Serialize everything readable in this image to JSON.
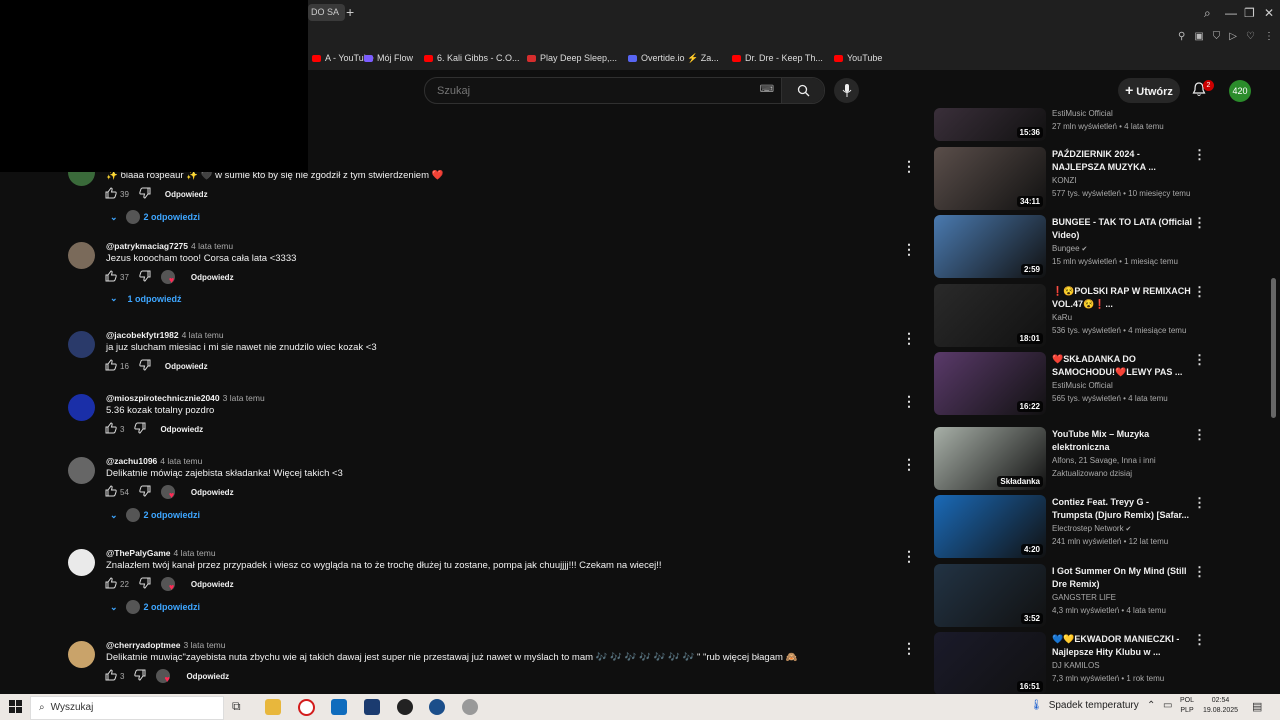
{
  "browser": {
    "active_tab": "DO SA",
    "bookmarks": [
      {
        "label": "A - YouTube",
        "color": "#ff0000"
      },
      {
        "label": "Mój Flow",
        "color": "#7b5cff"
      },
      {
        "label": "6. Kali Gibbs - C.O...",
        "color": "#ff0000"
      },
      {
        "label": "Play Deep Sleep,...",
        "color": "#d62d2d"
      },
      {
        "label": "Overtide.io ⚡ Za...",
        "color": "#5865f2"
      },
      {
        "label": "Dr. Dre - Keep Th...",
        "color": "#ff0000"
      },
      {
        "label": "YouTube",
        "color": "#ff0000"
      }
    ]
  },
  "header": {
    "search_placeholder": "Szukaj",
    "create_label": "Utwórz",
    "notif_count": "2",
    "avatar_text": "420"
  },
  "comments": [
    {
      "author": "",
      "time": "",
      "text": "✨ бiаaa гозрeaur ✨ 🖤 w sumie kto by się nie zgodził z tym stwierdzeniem ❤️",
      "likes": "39",
      "heart": false,
      "reply": "Odpowiedz",
      "replies": "2 odpowiedzi",
      "reply_avatar": true,
      "avatar_color": "#3a6a3a"
    },
    {
      "author": "@patrykmaciag7275",
      "time": "4 lata temu",
      "text": "Jezus kooocham tooo! Corsa cała lata <3333",
      "likes": "37",
      "heart": true,
      "reply": "Odpowiedz",
      "replies": "1 odpowiedź",
      "reply_avatar": false,
      "avatar_color": "#7a6a5a"
    },
    {
      "author": "@jacobekfytr1982",
      "time": "4 lata temu",
      "text": "ja juz slucham miesiac i mi sie nawet nie znudzilo wiec kozak <3",
      "likes": "16",
      "heart": false,
      "reply": "Odpowiedz",
      "replies": "",
      "reply_avatar": false,
      "avatar_color": "#2a3a6a"
    },
    {
      "author": "@mioszpirotechnicznie2040",
      "time": "3 lata temu",
      "text": "5.36 kozak totalny pozdro",
      "likes": "3",
      "heart": false,
      "reply": "Odpowiedz",
      "replies": "",
      "reply_avatar": false,
      "avatar_color": "#1a2fa8"
    },
    {
      "author": "@zachu1096",
      "time": "4 lata temu",
      "text": "Delikatnie mówiąc zajebista składanka! Więcej takich <3",
      "likes": "54",
      "heart": true,
      "reply": "Odpowiedz",
      "replies": "2 odpowiedzi",
      "reply_avatar": true,
      "avatar_color": "#666"
    },
    {
      "author": "@ThePalyGame",
      "time": "4 lata temu",
      "text": "Znalazłem twój kanał przez przypadek i wiesz co wygląda na to że trochę dłużej tu zostane, pompa jak chuujjjj!!! Czekam na wiecej!!",
      "likes": "22",
      "heart": true,
      "reply": "Odpowiedz",
      "replies": "2 odpowiedzi",
      "reply_avatar": true,
      "avatar_color": "#eaeaea"
    },
    {
      "author": "@cherryadoptmee",
      "time": "3 lata temu",
      "text": "Delikatnie muwiąc\"zayebista nuta zbychu wie aj takich dawaj jest super nie przestawaj już nawet w myślach to mam 🎶 🎶 🎶 🎶 🎶 🎶 🎶 \" \"rub więcej błagam 🙈",
      "likes": "3",
      "heart": true,
      "reply": "Odpowiedz",
      "replies": "",
      "reply_avatar": false,
      "avatar_color": "#c9a36a"
    }
  ],
  "videos": [
    {
      "title": "",
      "channel": "EstiMusic Official",
      "views": "27 mln wyświetleń • 4 lata temu",
      "duration": "15:36",
      "verified": false,
      "thumb": "#3a2f3a"
    },
    {
      "title": "PAŹDZIERNIK 2024 - NAJLEPSZA MUZYKA ...",
      "channel": "KONZI",
      "views": "577 tys. wyświetleń • 10 miesięcy temu",
      "duration": "34:11",
      "verified": false,
      "thumb": "#5a4e4a"
    },
    {
      "title": "BUNGEE - TAK TO LATA (Official Video)",
      "channel": "Bungee",
      "views": "15 mln wyświetleń • 1 miesiąc temu",
      "duration": "2:59",
      "verified": true,
      "thumb": "#4a7ab0"
    },
    {
      "title": "❗😵POLSKI RAP W REMIXACH VOL.47😵❗...",
      "channel": "KaRu",
      "views": "536 tys. wyświetleń • 4 miesiące temu",
      "duration": "18:01",
      "verified": false,
      "thumb": "#2a2a2a"
    },
    {
      "title": "❤️SKŁADANKA DO SAMOCHODU!❤️LEWY PAS ...",
      "channel": "EstiMusic Official",
      "views": "565 tys. wyświetleń • 4 lata temu",
      "duration": "16:22",
      "verified": false,
      "thumb": "#5a3a6a"
    },
    {
      "title": "YouTube Mix – Muzyka elektroniczna",
      "channel": "Alfons, 21 Savage, Inna i inni",
      "views": "Zaktualizowano dzisiaj",
      "duration": "Składanka",
      "verified": false,
      "thumb": "#a8b0a8"
    },
    {
      "title": "Contiez Feat. Treyy G - Trumpsta (Djuro Remix) [Safar...",
      "channel": "Electrostep Network",
      "views": "241 mln wyświetleń • 12 lat temu",
      "duration": "4:20",
      "verified": true,
      "thumb": "#1a6ab8"
    },
    {
      "title": "I Got Summer On My Mind (Still Dre Remix)",
      "channel": "GANGSTER LIFE",
      "views": "4,3 mln wyświetleń • 4 lata temu",
      "duration": "3:52",
      "verified": false,
      "thumb": "#223344"
    },
    {
      "title": "💙💛EKWADOR MANIECZKI - Najlepsze Hity Klubu w ...",
      "channel": "DJ KAMILOS",
      "views": "7,3 mln wyświetleń • 1 rok temu",
      "duration": "16:51",
      "verified": false,
      "thumb": "#1a1a2a"
    }
  ],
  "taskbar": {
    "search_placeholder": "Wyszukaj",
    "weather": "Spadek temperatury",
    "lang1": "POL",
    "lang2": "PLP",
    "time": "02:54",
    "date": "19.08.2025"
  }
}
